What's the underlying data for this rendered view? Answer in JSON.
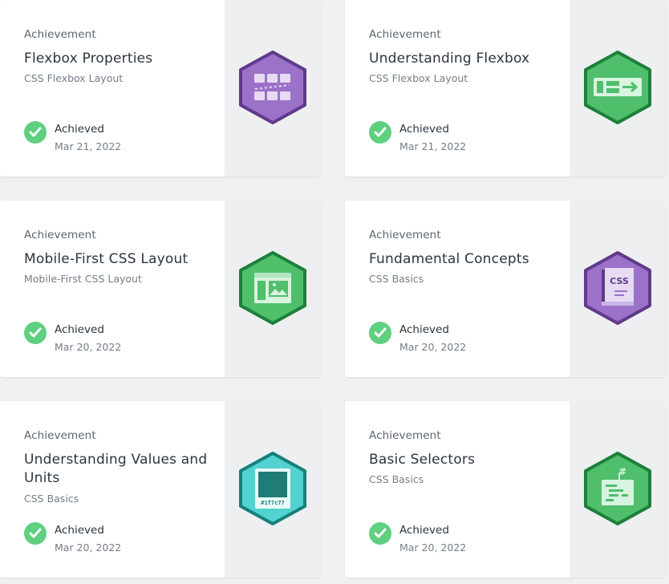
{
  "achievements": [
    {
      "kicker": "Achievement",
      "title": "Flexbox Properties",
      "course": "CSS Flexbox Layout",
      "status": "Achieved",
      "date": "Mar 21, 2022",
      "badge_icon": "flexbox-grid-icon",
      "badge_color": "#9b72c8"
    },
    {
      "kicker": "Achievement",
      "title": "Understanding Flexbox",
      "course": "CSS Flexbox Layout",
      "status": "Achieved",
      "date": "Mar 21, 2022",
      "badge_icon": "flex-arrow-icon",
      "badge_color": "#4fbf6c"
    },
    {
      "kicker": "Achievement",
      "title": "Mobile-First CSS Layout",
      "course": "Mobile-First CSS Layout",
      "status": "Achieved",
      "date": "Mar 20, 2022",
      "badge_icon": "layout-window-icon",
      "badge_color": "#4fbf6c"
    },
    {
      "kicker": "Achievement",
      "title": "Fundamental Concepts",
      "course": "CSS Basics",
      "status": "Achieved",
      "date": "Mar 20, 2022",
      "badge_icon": "css-book-icon",
      "badge_color": "#9b72c8"
    },
    {
      "kicker": "Achievement",
      "title": "Understanding Values and Units",
      "course": "CSS Basics",
      "status": "Achieved",
      "date": "Mar 20, 2022",
      "badge_icon": "color-swatch-icon",
      "badge_color": "#52d2d0",
      "badge_text": "#1f7c77"
    },
    {
      "kicker": "Achievement",
      "title": "Basic Selectors",
      "course": "CSS Basics",
      "status": "Achieved",
      "date": "Mar 20, 2022",
      "badge_icon": "selector-hash-icon",
      "badge_color": "#4fbf6c"
    }
  ]
}
